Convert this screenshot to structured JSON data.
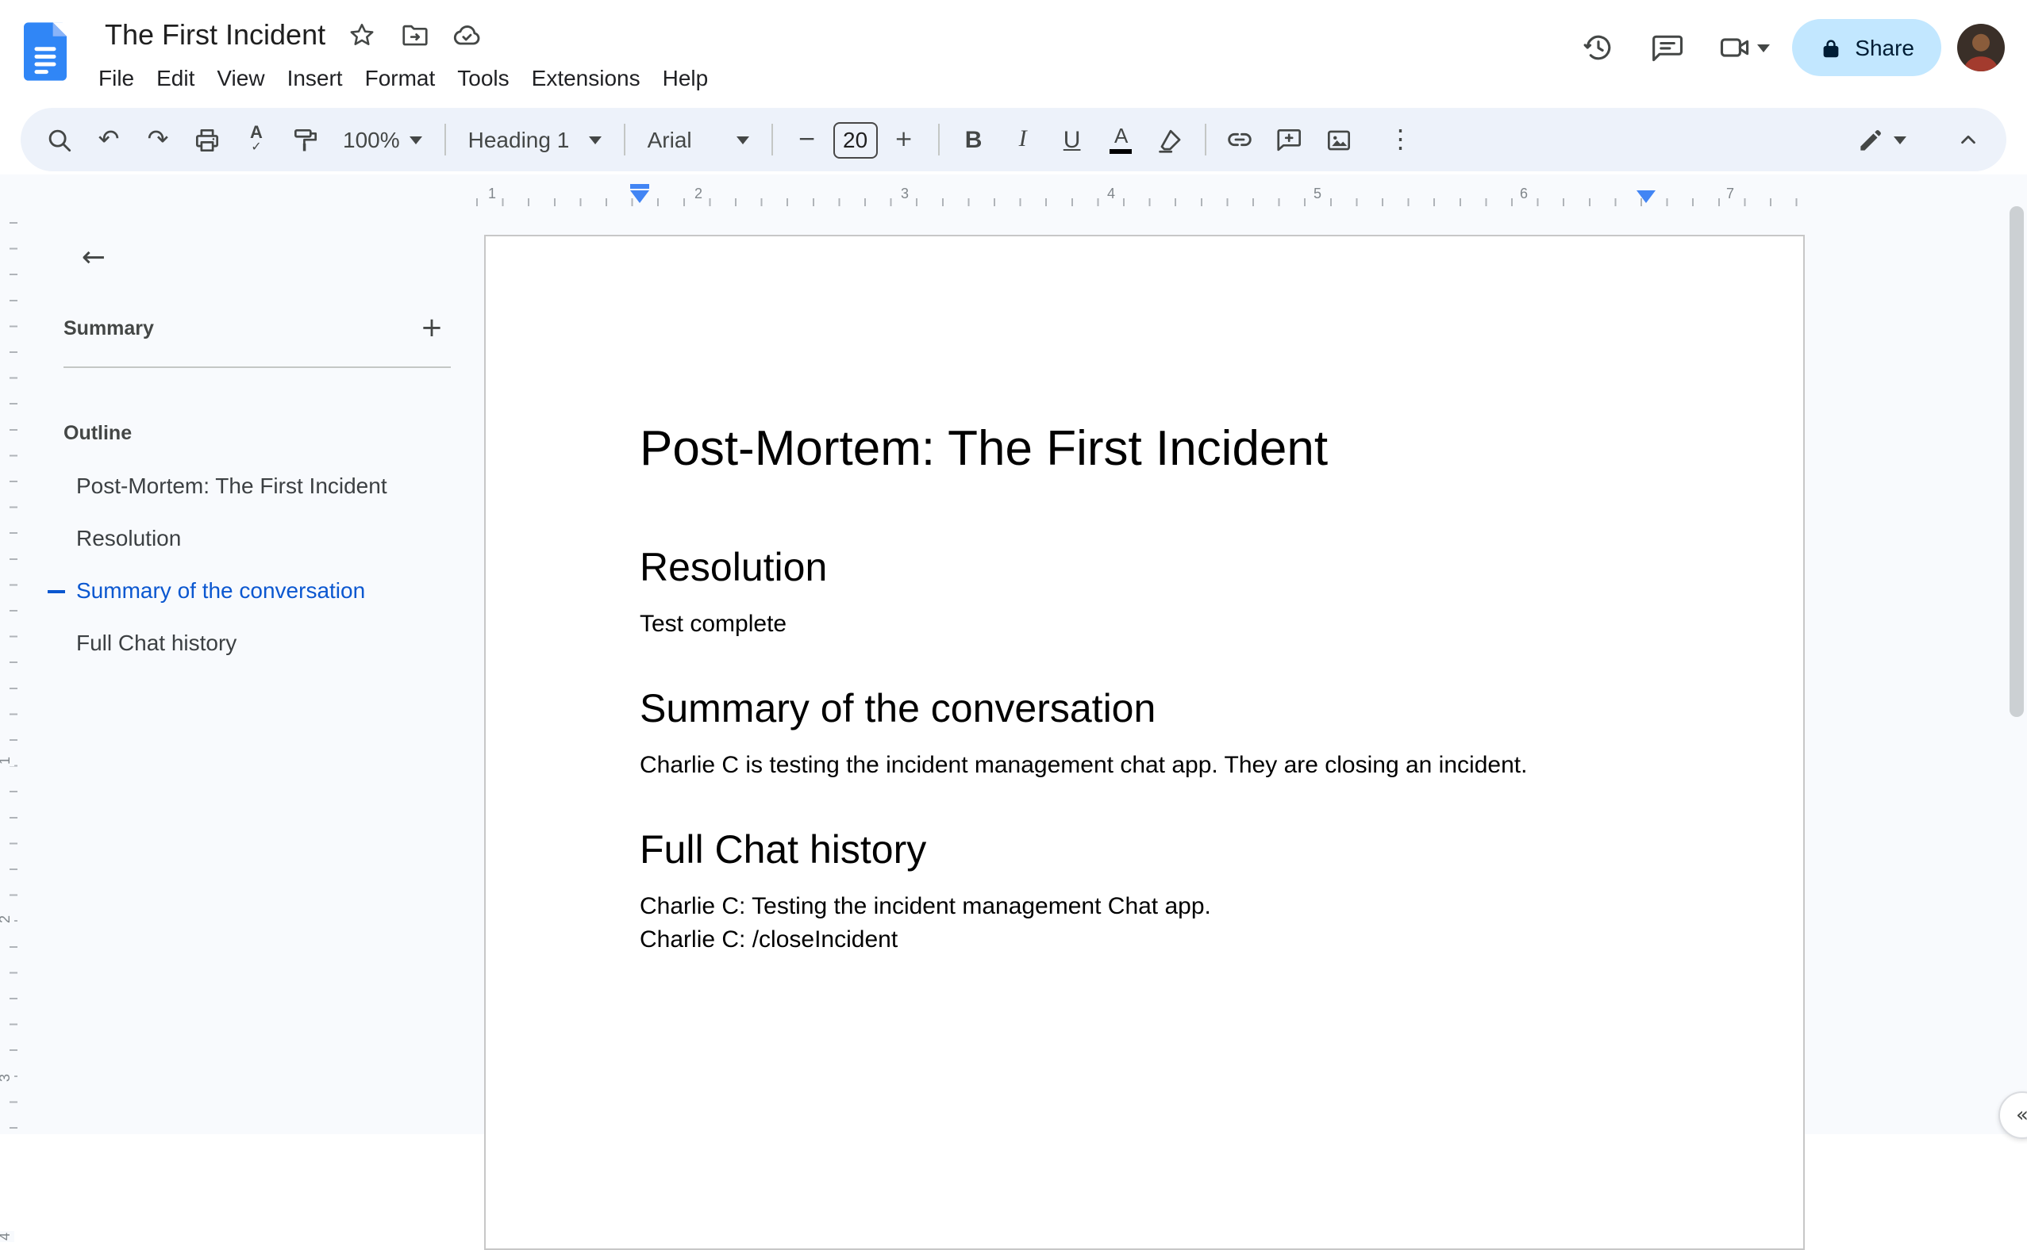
{
  "colors": {
    "accent": "#0b57d0",
    "toolbar_bg": "#edf2fa",
    "share_bg": "#c2e7ff",
    "logo_blue": "#3086f6",
    "indent_marker": "#4285f4"
  },
  "header": {
    "title": "The First Incident",
    "menu": [
      "File",
      "Edit",
      "View",
      "Insert",
      "Format",
      "Tools",
      "Extensions",
      "Help"
    ],
    "share_label": "Share"
  },
  "toolbar": {
    "zoom": "100%",
    "styles": "Heading 1",
    "font": "Arial",
    "font_size": "20",
    "bold": "B",
    "italic": "I",
    "underline": "U",
    "text_color": "A"
  },
  "icons": {
    "undo_glyph": "↶",
    "redo_glyph": "↷",
    "spell_a": "A",
    "spell_check": "✓",
    "more_glyph": "⋮",
    "back_arrow": "←",
    "plus": "+",
    "minus": "−",
    "expand_glyph": "«"
  },
  "ruler": {
    "h_numbers": [
      "1",
      "2",
      "3",
      "4",
      "5",
      "6",
      "7"
    ],
    "v_numbers": [
      "1",
      "2",
      "3",
      "4"
    ]
  },
  "outline": {
    "summary_label": "Summary",
    "outline_label": "Outline",
    "items": [
      {
        "label": "Post-Mortem: The First Incident",
        "active": false
      },
      {
        "label": "Resolution",
        "active": false
      },
      {
        "label": "Summary of the conversation",
        "active": true
      },
      {
        "label": "Full Chat history",
        "active": false
      }
    ]
  },
  "document": {
    "h1": "Post-Mortem: The First Incident",
    "sections": [
      {
        "heading": "Resolution",
        "paragraphs": [
          "Test complete"
        ]
      },
      {
        "heading": "Summary of the conversation",
        "paragraphs": [
          "Charlie C is testing the incident management chat app. They are closing an incident."
        ]
      },
      {
        "heading": "Full Chat history",
        "paragraphs": [
          "Charlie C: Testing the incident management Chat app.",
          "Charlie C: /closeIncident"
        ]
      }
    ]
  }
}
